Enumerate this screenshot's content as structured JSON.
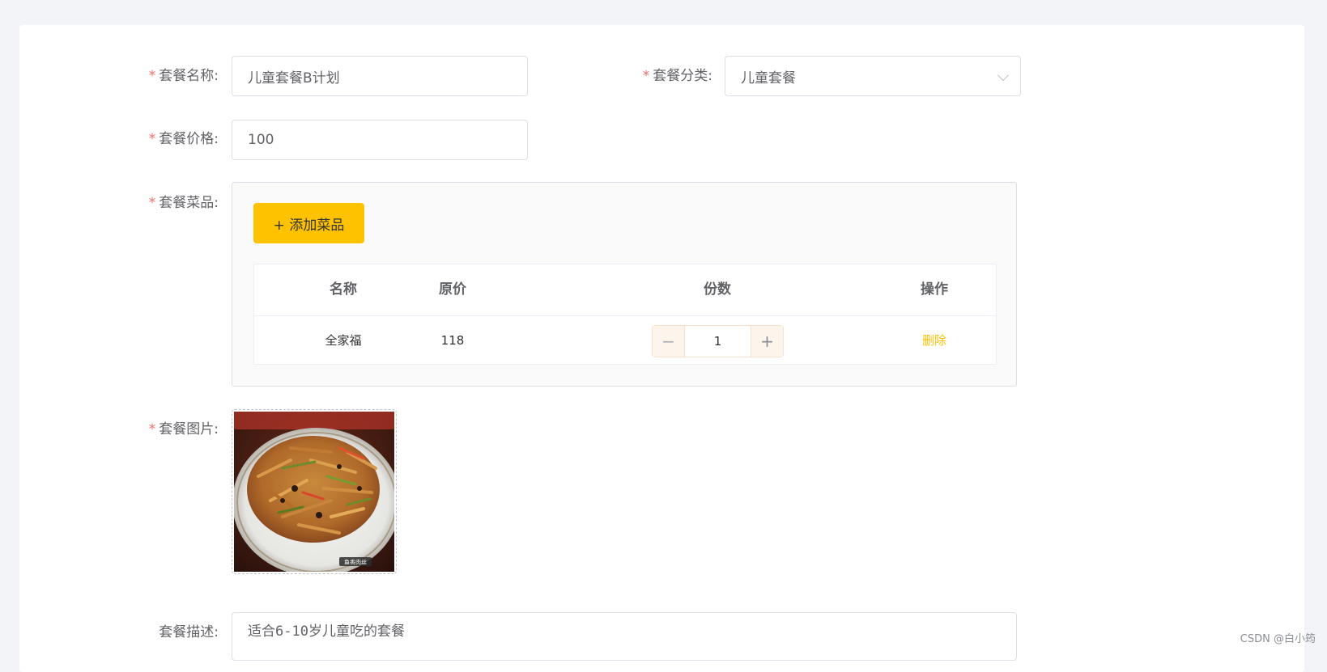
{
  "form": {
    "name": {
      "label": "套餐名称:",
      "value": "儿童套餐B计划"
    },
    "category": {
      "label": "套餐分类:",
      "value": "儿童套餐"
    },
    "price": {
      "label": "套餐价格:",
      "value": "100"
    },
    "dishes": {
      "label": "套餐菜品:",
      "add_button": "+ 添加菜品",
      "columns": [
        "名称",
        "原价",
        "份数",
        "操作"
      ],
      "rows": [
        {
          "name": "全家福",
          "price": "118",
          "copies": "1",
          "action": "删除"
        }
      ]
    },
    "image": {
      "label": "套餐图片:",
      "caption": "鱼香肉丝"
    },
    "description": {
      "label": "套餐描述:",
      "value": "适合6-10岁儿童吃的套餐"
    },
    "required_mark": "*"
  },
  "watermark": "CSDN @白小筠",
  "colors": {
    "accent": "#ffc200",
    "required": "#f56c6c",
    "page_bg": "#f3f4f7"
  }
}
